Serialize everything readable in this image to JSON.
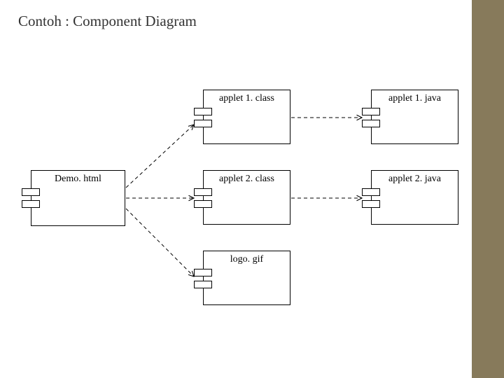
{
  "slide": {
    "title": "Contoh : Component Diagram"
  },
  "components": {
    "demo": {
      "label": "Demo. html"
    },
    "a1class": {
      "label": "applet 1. class"
    },
    "a2class": {
      "label": "applet 2. class"
    },
    "logo": {
      "label": "logo. gif"
    },
    "a1java": {
      "label": "applet 1. java"
    },
    "a2java": {
      "label": "applet 2. java"
    }
  }
}
